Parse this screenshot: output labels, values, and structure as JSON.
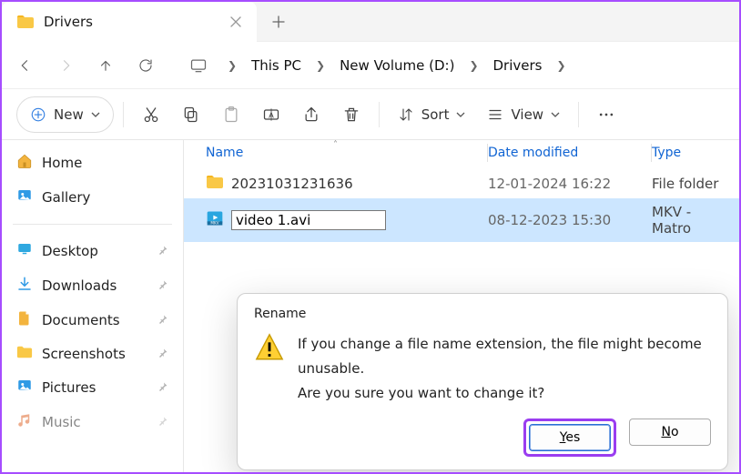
{
  "tab": {
    "title": "Drivers"
  },
  "nav": {
    "breadcrumb": [
      "This PC",
      "New Volume (D:)",
      "Drivers"
    ]
  },
  "toolbar": {
    "new_label": "New",
    "sort_label": "Sort",
    "view_label": "View"
  },
  "sidebar": {
    "quick": [
      {
        "icon": "home",
        "label": "Home"
      },
      {
        "icon": "gallery",
        "label": "Gallery"
      }
    ],
    "pinned": [
      {
        "icon": "desktop",
        "label": "Desktop"
      },
      {
        "icon": "downloads",
        "label": "Downloads"
      },
      {
        "icon": "documents",
        "label": "Documents"
      },
      {
        "icon": "screenshots",
        "label": "Screenshots"
      },
      {
        "icon": "pictures",
        "label": "Pictures"
      },
      {
        "icon": "music",
        "label": "Music"
      }
    ]
  },
  "columns": {
    "name": "Name",
    "date": "Date modified",
    "type": "Type"
  },
  "files": [
    {
      "icon": "folder",
      "name": "20231031231636",
      "date": "12-01-2024 16:22",
      "type": "File folder",
      "selected": false
    },
    {
      "icon": "video-mkv",
      "name": "video 1.avi",
      "date": "08-12-2023 15:30",
      "type": "MKV - Matro",
      "selected": true,
      "renaming": true
    }
  ],
  "dialog": {
    "title": "Rename",
    "message": "If you change a file name extension, the file might become unusable.",
    "prompt": "Are you sure you want to change it?",
    "yes": "Yes",
    "no": "No"
  }
}
